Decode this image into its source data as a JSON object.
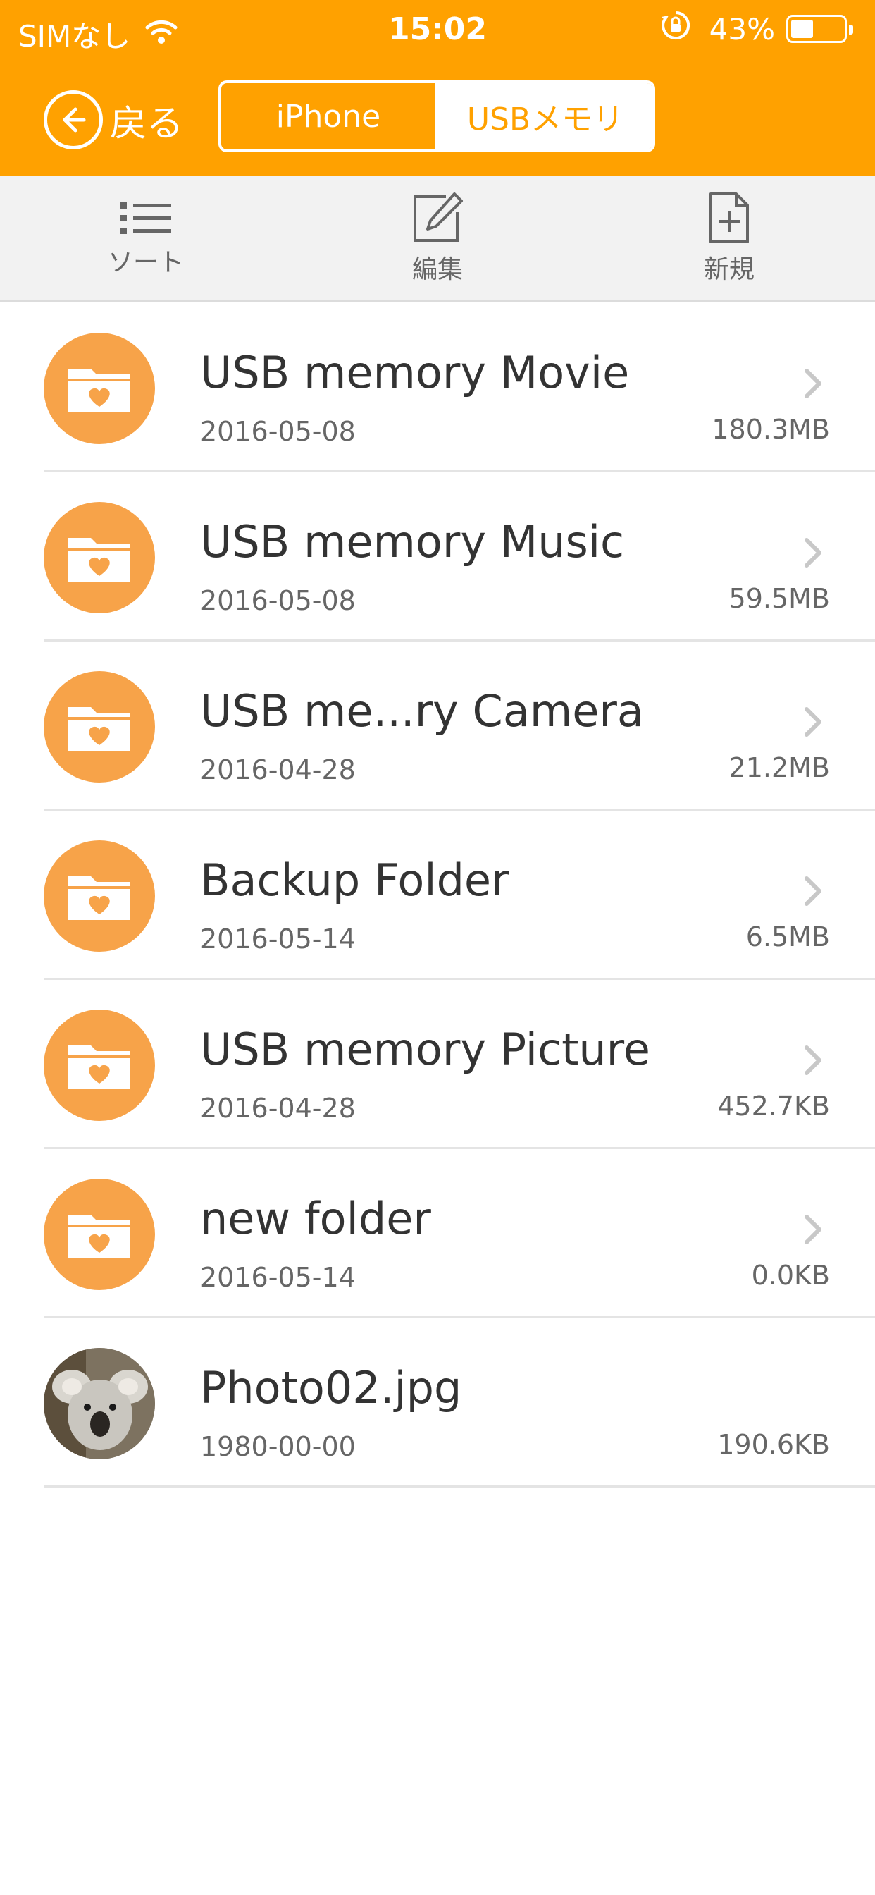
{
  "status_bar": {
    "carrier": "SIMなし",
    "time": "15:02",
    "battery": "43%",
    "battery_level": 0.43
  },
  "nav": {
    "back_label": "戻る",
    "segments": [
      {
        "label": "iPhone",
        "selected": false
      },
      {
        "label": "USBメモリ",
        "selected": true
      }
    ]
  },
  "toolbar": {
    "sort_label": "ソート",
    "edit_label": "編集",
    "new_label": "新規"
  },
  "files": [
    {
      "name": "USB memory Movie",
      "date": "2016-05-08",
      "size": "180.3MB",
      "type": "folder"
    },
    {
      "name": "USB memory Music",
      "date": "2016-05-08",
      "size": "59.5MB",
      "type": "folder"
    },
    {
      "name": "USB me...ry Camera",
      "date": "2016-04-28",
      "size": "21.2MB",
      "type": "folder"
    },
    {
      "name": "Backup Folder",
      "date": "2016-05-14",
      "size": "6.5MB",
      "type": "folder"
    },
    {
      "name": "USB memory Picture",
      "date": "2016-04-28",
      "size": "452.7KB",
      "type": "folder"
    },
    {
      "name": "new folder",
      "date": "2016-05-14",
      "size": "0.0KB",
      "type": "folder"
    },
    {
      "name": "Photo02.jpg",
      "date": "1980-00-00",
      "size": "190.6KB",
      "type": "image"
    }
  ],
  "colors": {
    "accent": "#ffa100",
    "folder": "#f7a349"
  },
  "icons": {
    "folder": "folder-heart-icon",
    "image": "koala-photo-thumbnail",
    "chevron": "chevron-right-icon"
  }
}
